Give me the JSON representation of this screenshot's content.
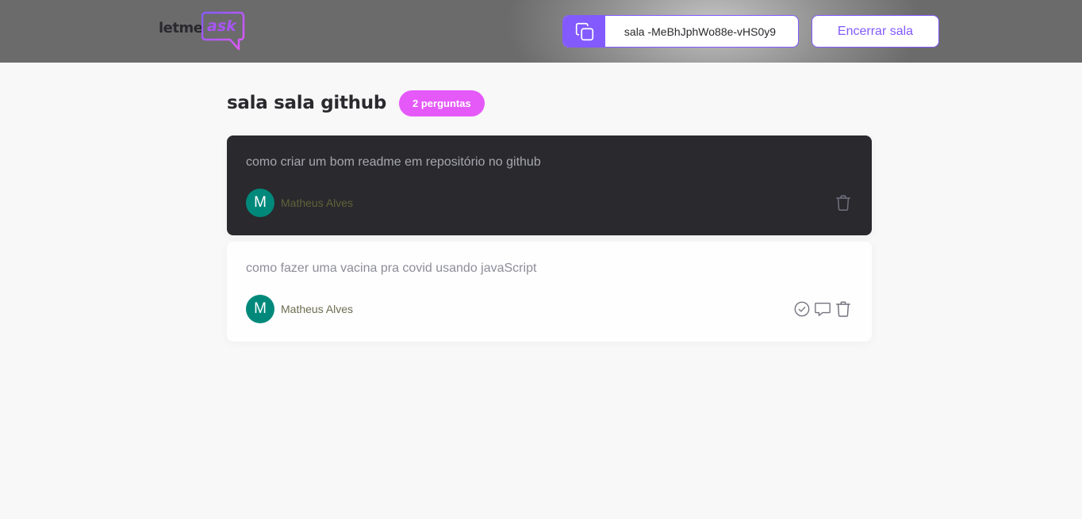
{
  "header": {
    "logo": {
      "part1": "letme",
      "part2": "ask"
    },
    "room_code": {
      "icon": "copy-icon",
      "text": "sala -MeBhJphWo88e-vHS0y9"
    },
    "close_button": "Encerrar sala"
  },
  "room": {
    "title": "sala sala github",
    "question_count": "2 perguntas"
  },
  "questions": [
    {
      "text": "como criar um bom readme em repositório no github",
      "author": {
        "initial": "M",
        "name": "Matheus Alves"
      },
      "highlighted": true,
      "actions": [
        "trash-icon"
      ]
    },
    {
      "text": "como fazer uma vacina pra covid usando javaScript",
      "author": {
        "initial": "M",
        "name": "Matheus Alves"
      },
      "highlighted": false,
      "actions": [
        "check-circle-icon",
        "message-icon",
        "trash-icon"
      ]
    }
  ],
  "colors": {
    "primary": "#835afd",
    "pink": "#e559f9",
    "dark_card": "#29292e",
    "avatar": "#00897b",
    "background": "#f8f8f8"
  }
}
